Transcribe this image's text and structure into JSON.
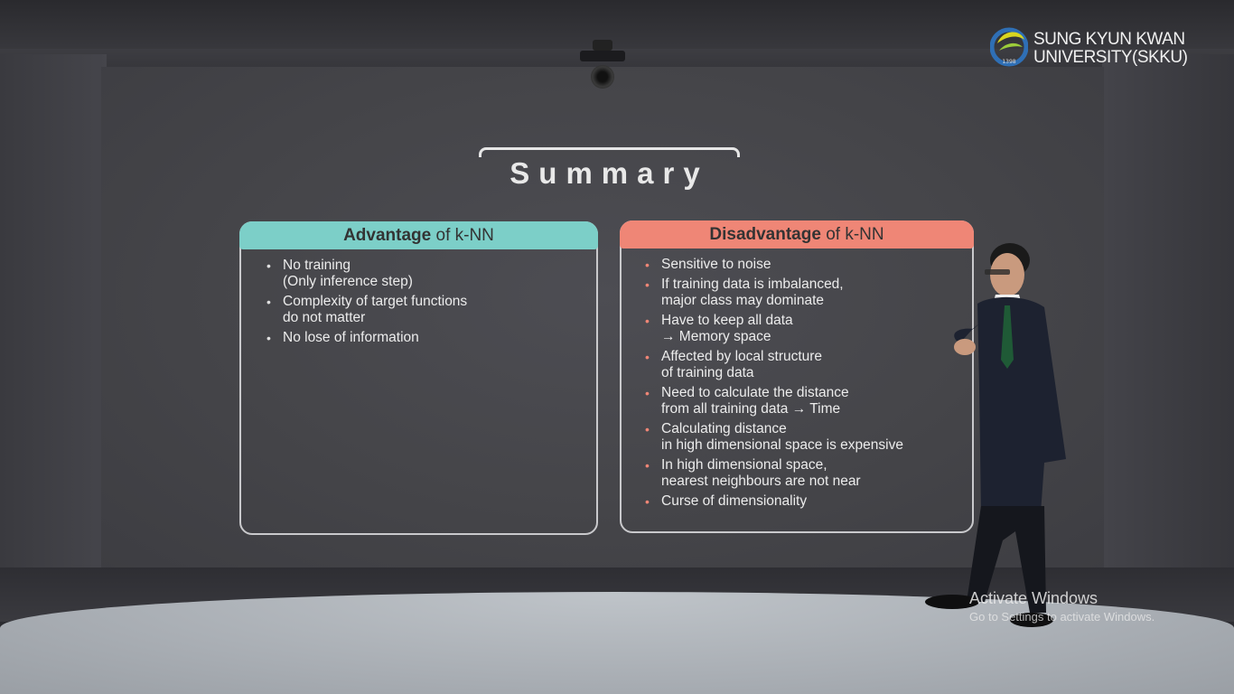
{
  "logo": {
    "line1": "SUNG KYUN KWAN",
    "line2": "UNIVERSITY(SKKU)",
    "seal_year": "1398"
  },
  "slide": {
    "title": "Summary",
    "advantage": {
      "heading_bold": "Advantage",
      "heading_rest": " of k-NN",
      "items": [
        {
          "lines": [
            "No training",
            "(Only inference step)"
          ]
        },
        {
          "lines": [
            "Complexity of target functions",
            "do not matter"
          ]
        },
        {
          "lines": [
            "No lose of information"
          ]
        }
      ]
    },
    "disadvantage": {
      "heading_bold": "Disadvantage",
      "heading_rest": " of k-NN",
      "items": [
        {
          "lines": [
            "Sensitive to noise"
          ]
        },
        {
          "lines": [
            "If training data is imbalanced,",
            "major class may dominate"
          ]
        },
        {
          "lines": [
            "Have to keep all data",
            "→ Memory space"
          ]
        },
        {
          "lines": [
            "Affected by local structure",
            "of training data"
          ]
        },
        {
          "lines": [
            "Need to calculate the distance",
            "from all training data → Time"
          ]
        },
        {
          "lines": [
            "Calculating distance",
            "in high dimensional space is expensive"
          ]
        },
        {
          "lines": [
            "In high dimensional space,",
            "nearest neighbours are not near"
          ]
        },
        {
          "lines": [
            "Curse of dimensionality"
          ]
        }
      ]
    },
    "bullet_char": "•"
  },
  "watermark": {
    "title": "Activate Windows",
    "subtitle": "Go to Settings to activate Windows."
  },
  "colors": {
    "advantage_header": "#7ccfc8",
    "disadvantage_header": "#ef8676",
    "text": "#ececec"
  }
}
